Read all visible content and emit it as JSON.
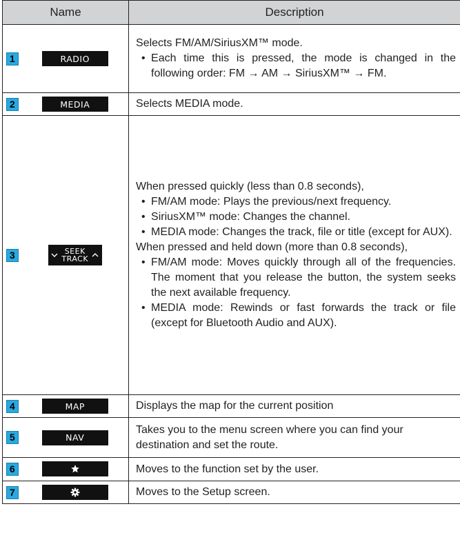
{
  "headers": {
    "name": "Name",
    "description": "Description"
  },
  "rows": [
    {
      "num": "1",
      "button": "RADIO",
      "intro": "Selects FM/AM/SiriusXM™ mode.",
      "bullets": [
        "Each time this is pressed, the mode is changed in the following order: FM → AM → SiriusXM™ → FM."
      ]
    },
    {
      "num": "2",
      "button": "MEDIA",
      "intro": "Selects MEDIA mode."
    },
    {
      "num": "3",
      "button_top": "SEEK",
      "button_bottom": "TRACK",
      "intro": "When pressed quickly (less than 0.8 seconds),",
      "bullets": [
        "FM/AM mode: Plays the previous/next frequency.",
        "SiriusXM™ mode: Changes the channel.",
        "MEDIA mode: Changes the track, file or title (except for AUX)."
      ],
      "intro2": "When pressed and held down (more than 0.8 seconds),",
      "bullets2": [
        "FM/AM mode: Moves quickly through all of the frequencies. The moment that you release the button, the system seeks the next available frequency.",
        "MEDIA mode: Rewinds or fast forwards the track or file (except for Bluetooth Audio and AUX)."
      ]
    },
    {
      "num": "4",
      "button": "MAP",
      "intro": "Displays the map for the current position"
    },
    {
      "num": "5",
      "button": "NAV",
      "intro": "Takes you to the menu screen where you can find your destination and set the route."
    },
    {
      "num": "6",
      "button_icon": "star-icon",
      "intro": "Moves to the function set by the user."
    },
    {
      "num": "7",
      "button_icon": "gear-icon",
      "intro": "Moves to the Setup screen."
    }
  ],
  "colors": {
    "header_bg": "#d1d3d4",
    "badge": "#29a9e0",
    "button_bg": "#111111"
  }
}
